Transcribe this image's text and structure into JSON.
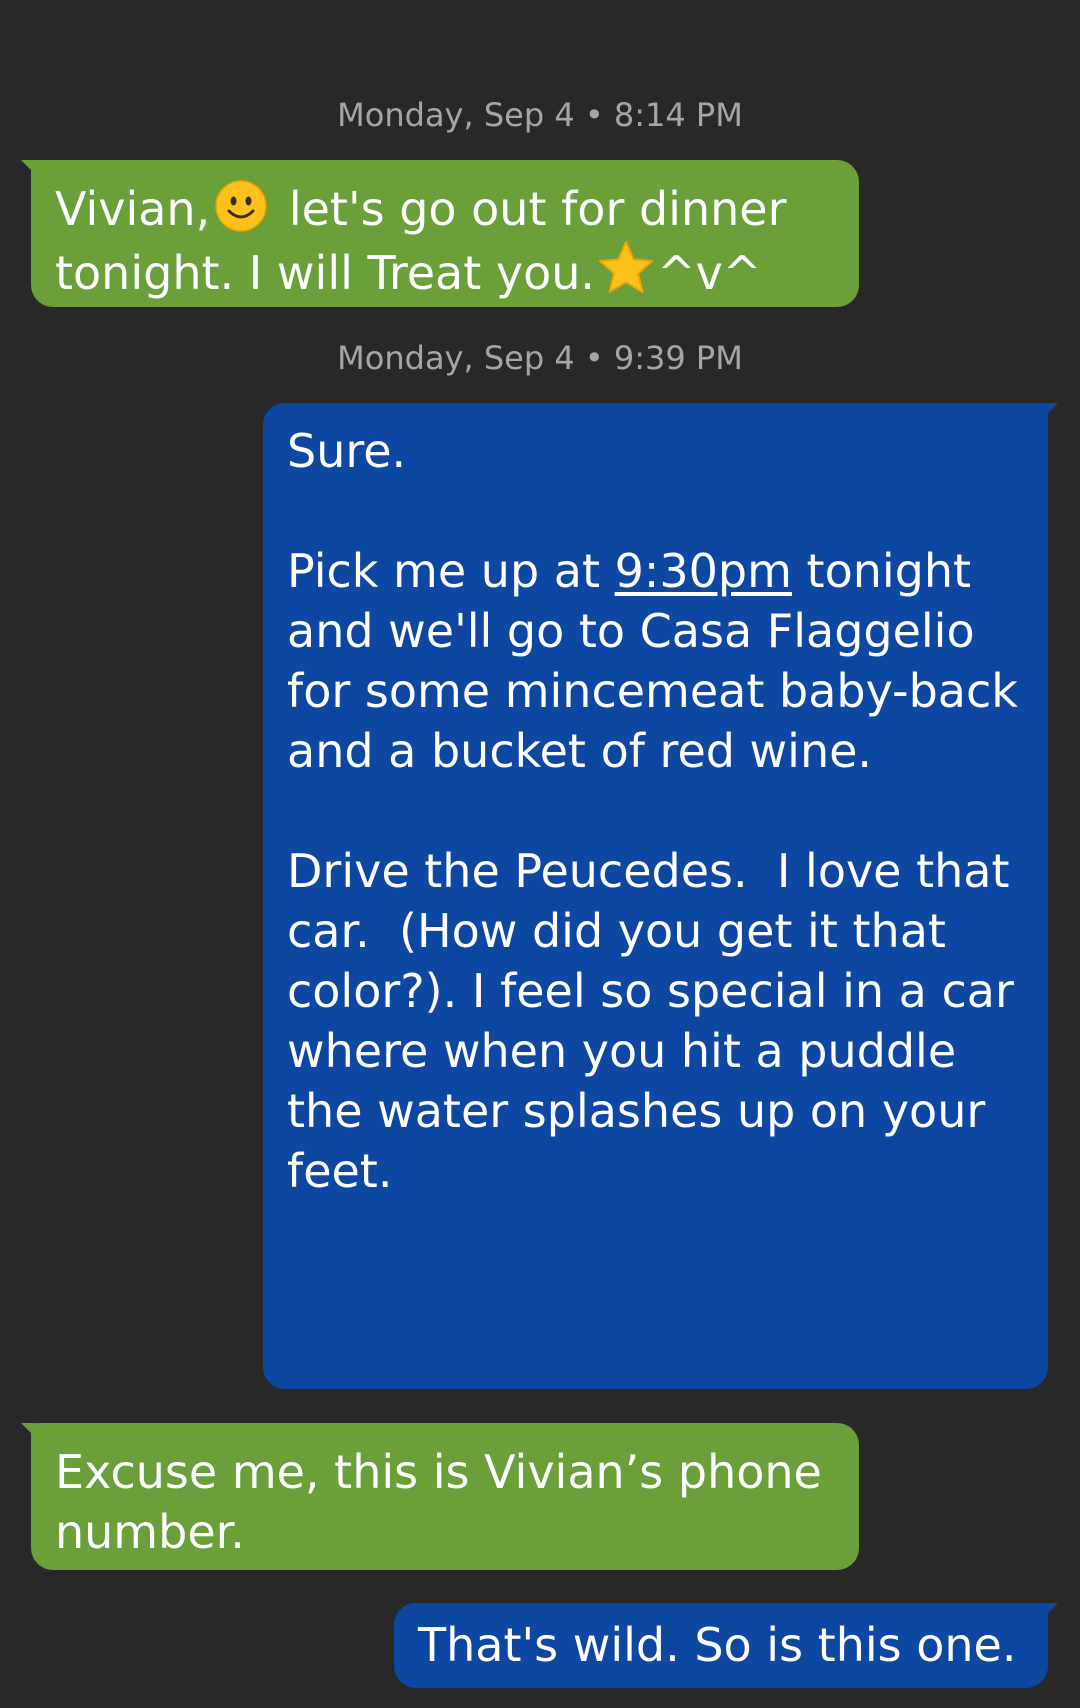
{
  "conversation": {
    "messages": [
      {
        "type": "timestamp",
        "text": "Monday, Sep 4 • 8:14 PM"
      },
      {
        "type": "received",
        "part1": "Vivian,",
        "part2": " let's go out for dinner tonight. I will Treat you.",
        "part3": "^v^",
        "emojis": [
          "smiling-face-icon",
          "star-icon"
        ]
      },
      {
        "type": "timestamp",
        "text": "Monday, Sep 4 • 9:39 PM"
      },
      {
        "type": "sent",
        "line1": "Sure.",
        "pre_link": "Pick me up at ",
        "link_text": "9:30pm",
        "post_link": " tonight and we'll go to Casa Flaggelio for some mincemeat baby-back and a bucket of red wine.",
        "para3": "Drive the Peucedes.  I love that car.  (How did you get it that color?). I feel so special in a car where when you hit a puddle the water splashes up on your feet."
      },
      {
        "type": "received",
        "text": "Excuse me, this is Vivian’s phone number."
      },
      {
        "type": "sent",
        "text": "That's wild.  So is this one."
      }
    ]
  },
  "colors": {
    "background": "#282828",
    "received_bubble": "#6a9f3a",
    "sent_bubble": "#0d47a1",
    "timestamp_text": "#a6a6a6",
    "message_text": "#ffffff"
  }
}
